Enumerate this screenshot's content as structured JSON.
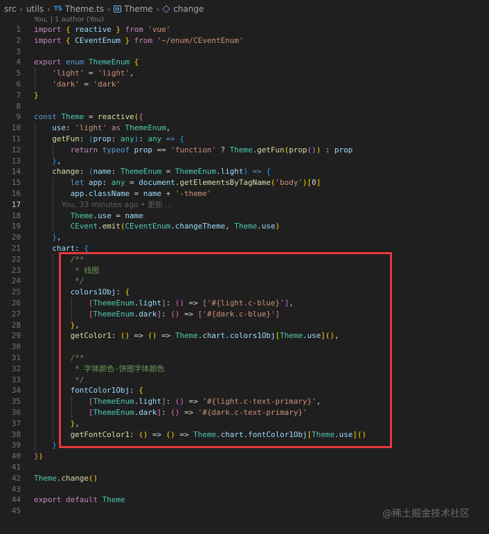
{
  "breadcrumb": {
    "items": [
      "src",
      "utils",
      "Theme.ts",
      "Theme",
      "change"
    ],
    "ts_badge": "TS"
  },
  "codelens": "You, | 1 author (You)",
  "blame": "You, 33 minutes ago • 更新 …",
  "active_line": 17,
  "watermark": "@稀土掘金技术社区",
  "highlight_color": "#e8383d",
  "lines": [
    {
      "n": "1",
      "t": [
        [
          "ctrl",
          "import"
        ],
        [
          "op",
          " "
        ],
        [
          "b1",
          "{"
        ],
        [
          "op",
          " "
        ],
        [
          "var",
          "reactive"
        ],
        [
          "op",
          " "
        ],
        [
          "b1",
          "}"
        ],
        [
          "op",
          " "
        ],
        [
          "ctrl",
          "from"
        ],
        [
          "op",
          " "
        ],
        [
          "str",
          "'vue'"
        ]
      ]
    },
    {
      "n": "2",
      "t": [
        [
          "ctrl",
          "import"
        ],
        [
          "op",
          " "
        ],
        [
          "b1",
          "{"
        ],
        [
          "op",
          " "
        ],
        [
          "var",
          "CEventEnum"
        ],
        [
          "op",
          " "
        ],
        [
          "b1",
          "}"
        ],
        [
          "op",
          " "
        ],
        [
          "ctrl",
          "from"
        ],
        [
          "op",
          " "
        ],
        [
          "str",
          "'~/enum/CEventEnum'"
        ]
      ]
    },
    {
      "n": "3",
      "t": []
    },
    {
      "n": "4",
      "t": [
        [
          "ctrl",
          "export"
        ],
        [
          "op",
          " "
        ],
        [
          "kw",
          "enum"
        ],
        [
          "op",
          " "
        ],
        [
          "type",
          "ThemeEnum"
        ],
        [
          "op",
          " "
        ],
        [
          "b1",
          "{"
        ]
      ]
    },
    {
      "n": "5",
      "t": [
        [
          "op",
          "    "
        ],
        [
          "str",
          "'light'"
        ],
        [
          "op",
          " = "
        ],
        [
          "str",
          "'light'"
        ],
        [
          "op",
          ","
        ]
      ]
    },
    {
      "n": "6",
      "t": [
        [
          "op",
          "    "
        ],
        [
          "str",
          "'dark'"
        ],
        [
          "op",
          " = "
        ],
        [
          "str",
          "'dark'"
        ]
      ]
    },
    {
      "n": "7",
      "t": [
        [
          "b1",
          "}"
        ]
      ]
    },
    {
      "n": "8",
      "t": []
    },
    {
      "n": "9",
      "t": [
        [
          "kw",
          "const"
        ],
        [
          "op",
          " "
        ],
        [
          "type",
          "Theme"
        ],
        [
          "op",
          " = "
        ],
        [
          "fn",
          "reactive"
        ],
        [
          "b1",
          "("
        ],
        [
          "b2",
          "{"
        ]
      ]
    },
    {
      "n": "10",
      "t": [
        [
          "op",
          "    "
        ],
        [
          "var",
          "use"
        ],
        [
          "op",
          ": "
        ],
        [
          "str",
          "'light'"
        ],
        [
          "op",
          " "
        ],
        [
          "ctrl",
          "as"
        ],
        [
          "op",
          " "
        ],
        [
          "type",
          "ThemeEnum"
        ],
        [
          "op",
          ","
        ]
      ]
    },
    {
      "n": "11",
      "t": [
        [
          "op",
          "    "
        ],
        [
          "fn",
          "getFun"
        ],
        [
          "op",
          ": "
        ],
        [
          "b3",
          "("
        ],
        [
          "var",
          "prop"
        ],
        [
          "op",
          ": "
        ],
        [
          "type",
          "any"
        ],
        [
          "b3",
          ")"
        ],
        [
          "op",
          ": "
        ],
        [
          "type",
          "any"
        ],
        [
          "op",
          " "
        ],
        [
          "kw",
          "=>"
        ],
        [
          "op",
          " "
        ],
        [
          "b3",
          "{"
        ]
      ]
    },
    {
      "n": "12",
      "t": [
        [
          "op",
          "        "
        ],
        [
          "ctrl",
          "return"
        ],
        [
          "op",
          " "
        ],
        [
          "kw",
          "typeof"
        ],
        [
          "op",
          " "
        ],
        [
          "var",
          "prop"
        ],
        [
          "op",
          " == "
        ],
        [
          "str",
          "'function'"
        ],
        [
          "op",
          " ? "
        ],
        [
          "type",
          "Theme"
        ],
        [
          "op",
          "."
        ],
        [
          "fn",
          "getFun"
        ],
        [
          "b1",
          "("
        ],
        [
          "fn",
          "prop"
        ],
        [
          "b2",
          "("
        ],
        [
          "b2",
          ")"
        ],
        [
          "b1",
          ")"
        ],
        [
          "op",
          " : "
        ],
        [
          "var",
          "prop"
        ]
      ]
    },
    {
      "n": "13",
      "t": [
        [
          "op",
          "    "
        ],
        [
          "b3",
          "}"
        ],
        [
          "op",
          ","
        ]
      ]
    },
    {
      "n": "14",
      "t": [
        [
          "op",
          "    "
        ],
        [
          "fn",
          "change"
        ],
        [
          "op",
          ": "
        ],
        [
          "b3",
          "("
        ],
        [
          "var",
          "name"
        ],
        [
          "op",
          ": "
        ],
        [
          "type",
          "ThemeEnum"
        ],
        [
          "op",
          " = "
        ],
        [
          "type",
          "ThemeEnum"
        ],
        [
          "op",
          "."
        ],
        [
          "var",
          "light"
        ],
        [
          "b3",
          ")"
        ],
        [
          "op",
          " "
        ],
        [
          "kw",
          "=>"
        ],
        [
          "op",
          " "
        ],
        [
          "b3",
          "{"
        ]
      ]
    },
    {
      "n": "15",
      "t": [
        [
          "op",
          "        "
        ],
        [
          "kw",
          "let"
        ],
        [
          "op",
          " "
        ],
        [
          "var",
          "app"
        ],
        [
          "op",
          ": "
        ],
        [
          "type",
          "any"
        ],
        [
          "op",
          " = "
        ],
        [
          "var",
          "document"
        ],
        [
          "op",
          "."
        ],
        [
          "fn",
          "getElementsByTagName"
        ],
        [
          "b1",
          "("
        ],
        [
          "str",
          "'body'"
        ],
        [
          "b1",
          ")"
        ],
        [
          "b1",
          "["
        ],
        [
          "op",
          "0"
        ],
        [
          "b1",
          "]"
        ]
      ]
    },
    {
      "n": "16",
      "t": [
        [
          "op",
          "        "
        ],
        [
          "var",
          "app"
        ],
        [
          "op",
          "."
        ],
        [
          "var",
          "className"
        ],
        [
          "op",
          " = "
        ],
        [
          "var",
          "name"
        ],
        [
          "op",
          " + "
        ],
        [
          "str",
          "'-theme'"
        ]
      ]
    },
    {
      "n": "17",
      "t": []
    },
    {
      "n": "18",
      "t": [
        [
          "op",
          "        "
        ],
        [
          "type",
          "Theme"
        ],
        [
          "op",
          "."
        ],
        [
          "var",
          "use"
        ],
        [
          "op",
          " = "
        ],
        [
          "var",
          "name"
        ]
      ]
    },
    {
      "n": "19",
      "t": [
        [
          "op",
          "        "
        ],
        [
          "type",
          "CEvent"
        ],
        [
          "op",
          "."
        ],
        [
          "fn",
          "emit"
        ],
        [
          "b1",
          "("
        ],
        [
          "type",
          "CEventEnum"
        ],
        [
          "op",
          "."
        ],
        [
          "var",
          "changeTheme"
        ],
        [
          "op",
          ", "
        ],
        [
          "type",
          "Theme"
        ],
        [
          "op",
          "."
        ],
        [
          "var",
          "use"
        ],
        [
          "b1",
          ")"
        ]
      ]
    },
    {
      "n": "20",
      "t": [
        [
          "op",
          "    "
        ],
        [
          "b3",
          "}"
        ],
        [
          "op",
          ","
        ]
      ]
    },
    {
      "n": "21",
      "t": [
        [
          "op",
          "    "
        ],
        [
          "var",
          "chart"
        ],
        [
          "op",
          ": "
        ],
        [
          "b3",
          "{"
        ]
      ]
    },
    {
      "n": "22",
      "t": [
        [
          "op",
          "        "
        ],
        [
          "cmt",
          "/**"
        ]
      ]
    },
    {
      "n": "23",
      "t": [
        [
          "op",
          "        "
        ],
        [
          "cmt",
          " * 线图"
        ]
      ]
    },
    {
      "n": "24",
      "t": [
        [
          "op",
          "        "
        ],
        [
          "cmt",
          " */"
        ]
      ]
    },
    {
      "n": "25",
      "t": [
        [
          "op",
          "        "
        ],
        [
          "var",
          "colors1Obj"
        ],
        [
          "op",
          ": "
        ],
        [
          "b1",
          "{"
        ]
      ]
    },
    {
      "n": "26",
      "t": [
        [
          "op",
          "            "
        ],
        [
          "b2",
          "["
        ],
        [
          "type",
          "ThemeEnum"
        ],
        [
          "op",
          "."
        ],
        [
          "var",
          "light"
        ],
        [
          "b2",
          "]"
        ],
        [
          "op",
          ": "
        ],
        [
          "b2",
          "("
        ],
        [
          "b2",
          ")"
        ],
        [
          "op",
          " => "
        ],
        [
          "b2",
          "["
        ],
        [
          "str",
          "'#{light.c-blue}'"
        ],
        [
          "b2",
          "]"
        ],
        [
          "op",
          ","
        ]
      ]
    },
    {
      "n": "27",
      "t": [
        [
          "op",
          "            "
        ],
        [
          "b2",
          "["
        ],
        [
          "type",
          "ThemeEnum"
        ],
        [
          "op",
          "."
        ],
        [
          "var",
          "dark"
        ],
        [
          "b2",
          "]"
        ],
        [
          "op",
          ": "
        ],
        [
          "b2",
          "("
        ],
        [
          "b2",
          ")"
        ],
        [
          "op",
          " => "
        ],
        [
          "b2",
          "["
        ],
        [
          "str",
          "'#{dark.c-blue}'"
        ],
        [
          "b2",
          "]"
        ]
      ]
    },
    {
      "n": "28",
      "t": [
        [
          "op",
          "        "
        ],
        [
          "b1",
          "}"
        ],
        [
          "op",
          ","
        ]
      ]
    },
    {
      "n": "29",
      "t": [
        [
          "op",
          "        "
        ],
        [
          "fn",
          "getColor1"
        ],
        [
          "op",
          ": "
        ],
        [
          "b1",
          "("
        ],
        [
          "b1",
          ")"
        ],
        [
          "op",
          " => "
        ],
        [
          "b1",
          "("
        ],
        [
          "b1",
          ")"
        ],
        [
          "op",
          " => "
        ],
        [
          "type",
          "Theme"
        ],
        [
          "op",
          "."
        ],
        [
          "var",
          "chart"
        ],
        [
          "op",
          "."
        ],
        [
          "var",
          "colors1Obj"
        ],
        [
          "b1",
          "["
        ],
        [
          "type",
          "Theme"
        ],
        [
          "op",
          "."
        ],
        [
          "var",
          "use"
        ],
        [
          "b1",
          "]"
        ],
        [
          "b1",
          "("
        ],
        [
          "b1",
          ")"
        ],
        [
          "op",
          ","
        ]
      ]
    },
    {
      "n": "30",
      "t": []
    },
    {
      "n": "31",
      "t": [
        [
          "op",
          "        "
        ],
        [
          "cmt",
          "/**"
        ]
      ]
    },
    {
      "n": "32",
      "t": [
        [
          "op",
          "        "
        ],
        [
          "cmt",
          " * 字体颜色-饼图字体颜色"
        ]
      ]
    },
    {
      "n": "33",
      "t": [
        [
          "op",
          "        "
        ],
        [
          "cmt",
          " */"
        ]
      ]
    },
    {
      "n": "34",
      "t": [
        [
          "op",
          "        "
        ],
        [
          "var",
          "fontColor1Obj"
        ],
        [
          "op",
          ": "
        ],
        [
          "b1",
          "{"
        ]
      ]
    },
    {
      "n": "35",
      "t": [
        [
          "op",
          "            "
        ],
        [
          "b2",
          "["
        ],
        [
          "type",
          "ThemeEnum"
        ],
        [
          "op",
          "."
        ],
        [
          "var",
          "light"
        ],
        [
          "b2",
          "]"
        ],
        [
          "op",
          ": "
        ],
        [
          "b2",
          "("
        ],
        [
          "b2",
          ")"
        ],
        [
          "op",
          " => "
        ],
        [
          "str",
          "'#{light.c-text-primary}'"
        ],
        [
          "op",
          ","
        ]
      ]
    },
    {
      "n": "36",
      "t": [
        [
          "op",
          "            "
        ],
        [
          "b2",
          "["
        ],
        [
          "type",
          "ThemeEnum"
        ],
        [
          "op",
          "."
        ],
        [
          "var",
          "dark"
        ],
        [
          "b2",
          "]"
        ],
        [
          "op",
          ": "
        ],
        [
          "b2",
          "("
        ],
        [
          "b2",
          ")"
        ],
        [
          "op",
          " => "
        ],
        [
          "str",
          "'#{dark.c-text-primary}'"
        ]
      ]
    },
    {
      "n": "37",
      "t": [
        [
          "op",
          "        "
        ],
        [
          "b1",
          "}"
        ],
        [
          "op",
          ","
        ]
      ]
    },
    {
      "n": "38",
      "t": [
        [
          "op",
          "        "
        ],
        [
          "fn",
          "getFontColor1"
        ],
        [
          "op",
          ": "
        ],
        [
          "b1",
          "("
        ],
        [
          "b1",
          ")"
        ],
        [
          "op",
          " => "
        ],
        [
          "b1",
          "("
        ],
        [
          "b1",
          ")"
        ],
        [
          "op",
          " => "
        ],
        [
          "type",
          "Theme"
        ],
        [
          "op",
          "."
        ],
        [
          "var",
          "chart"
        ],
        [
          "op",
          "."
        ],
        [
          "var",
          "fontColor1Obj"
        ],
        [
          "b1",
          "["
        ],
        [
          "type",
          "Theme"
        ],
        [
          "op",
          "."
        ],
        [
          "var",
          "use"
        ],
        [
          "b1",
          "]"
        ],
        [
          "b1",
          "("
        ],
        [
          "b1",
          ")"
        ]
      ]
    },
    {
      "n": "39",
      "t": [
        [
          "op",
          "    "
        ],
        [
          "b3",
          "}"
        ]
      ]
    },
    {
      "n": "40",
      "t": [
        [
          "b2",
          "}"
        ],
        [
          "b1",
          ")"
        ]
      ]
    },
    {
      "n": "41",
      "t": []
    },
    {
      "n": "42",
      "t": [
        [
          "type",
          "Theme"
        ],
        [
          "op",
          "."
        ],
        [
          "fn",
          "change"
        ],
        [
          "b1",
          "("
        ],
        [
          "b1",
          ")"
        ]
      ]
    },
    {
      "n": "43",
      "t": []
    },
    {
      "n": "44",
      "t": [
        [
          "ctrl",
          "export"
        ],
        [
          "op",
          " "
        ],
        [
          "ctrl",
          "default"
        ],
        [
          "op",
          " "
        ],
        [
          "type",
          "Theme"
        ]
      ]
    },
    {
      "n": "45",
      "t": []
    }
  ]
}
